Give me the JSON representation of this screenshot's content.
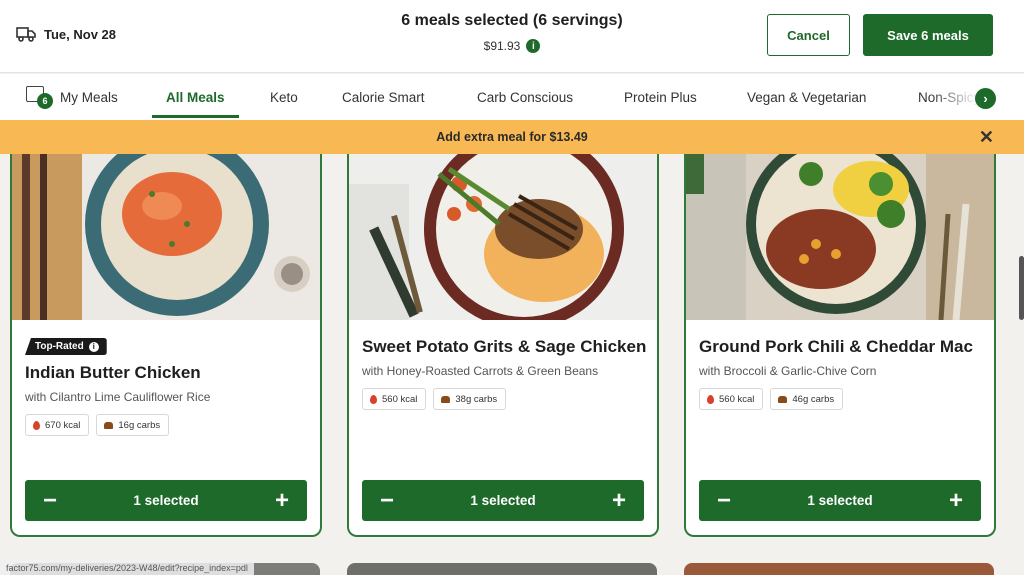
{
  "header": {
    "delivery_date": "Tue, Nov 28",
    "summary_title": "6 meals selected (6 servings)",
    "summary_price": "$91.93",
    "info_icon": "i",
    "cancel_label": "Cancel",
    "save_label": "Save 6 meals"
  },
  "tabs": {
    "my_meals_badge": "6",
    "items": [
      "My Meals",
      "All Meals",
      "Keto",
      "Calorie Smart",
      "Carb Conscious",
      "Protein Plus",
      "Vegan & Vegetarian",
      "Non-Spicy"
    ],
    "active": "All Meals",
    "next_icon": "›"
  },
  "banner": {
    "text": "Add extra meal for $13.49",
    "close_icon": "✕"
  },
  "meals": [
    {
      "badge": "Top-Rated",
      "name": "Indian Butter Chicken",
      "side": "with Cilantro Lime Cauliflower Rice",
      "kcal": "670 kcal",
      "carbs": "16g carbs",
      "selected": "1 selected"
    },
    {
      "name": "Sweet Potato Grits & Sage Chicken",
      "side": "with Honey-Roasted Carrots & Green Beans",
      "kcal": "560 kcal",
      "carbs": "38g carbs",
      "selected": "1 selected"
    },
    {
      "name": "Ground Pork Chili & Cheddar Mac",
      "side": "with Broccoli & Garlic-Chive Corn",
      "kcal": "560 kcal",
      "carbs": "46g carbs",
      "selected": "1 selected"
    }
  ],
  "stepper": {
    "minus": "−",
    "plus": "+"
  },
  "status_url": "factor75.com/my-deliveries/2023-W48/edit?recipe_index=pdl",
  "colors": {
    "brand_green": "#1e6a2a",
    "banner_orange": "#f8b955"
  }
}
